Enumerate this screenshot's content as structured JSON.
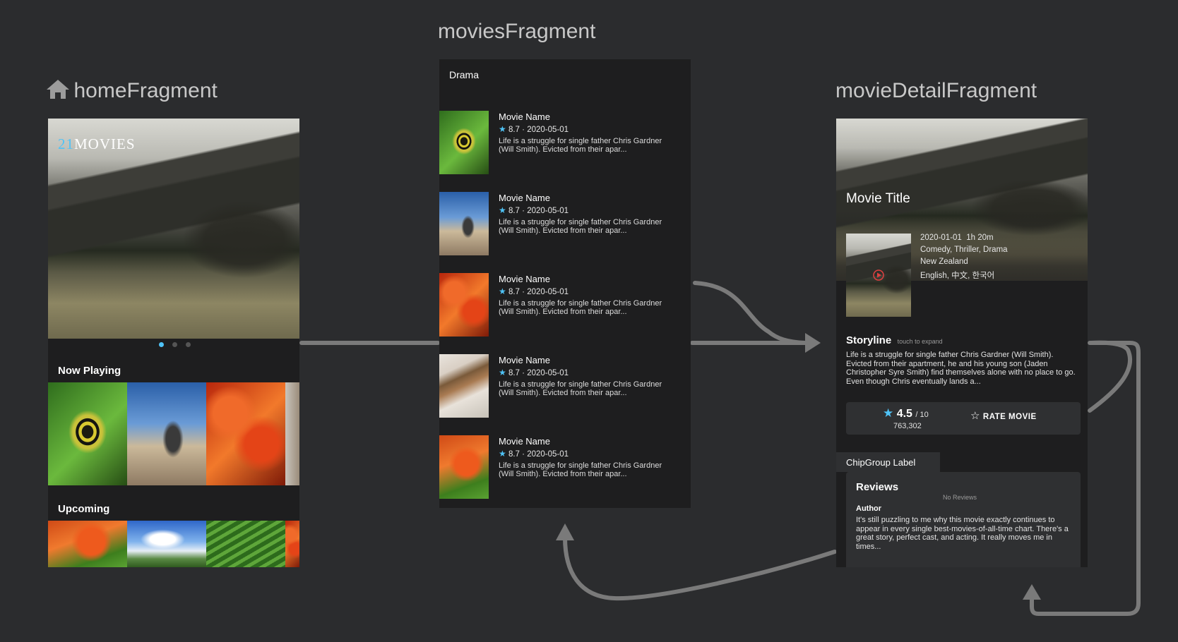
{
  "home": {
    "title": "homeFragment",
    "logo_part1": "21",
    "logo_part2": "MOVIES",
    "now_playing": "Now Playing",
    "upcoming": "Upcoming"
  },
  "movies": {
    "title": "moviesFragment",
    "genre": "Drama",
    "items": [
      {
        "name": "Movie Name",
        "rating": "8.7",
        "date": "2020-05-01",
        "desc": "Life is a struggle for single father Chris Gardner (Will Smith). Evicted from their apar..."
      },
      {
        "name": "Movie Name",
        "rating": "8.7",
        "date": "2020-05-01",
        "desc": "Life is a struggle for single father Chris Gardner (Will Smith). Evicted from their apar..."
      },
      {
        "name": "Movie Name",
        "rating": "8.7",
        "date": "2020-05-01",
        "desc": "Life is a struggle for single father Chris Gardner (Will Smith). Evicted from their apar..."
      },
      {
        "name": "Movie Name",
        "rating": "8.7",
        "date": "2020-05-01",
        "desc": "Life is a struggle for single father Chris Gardner (Will Smith). Evicted from their apar..."
      },
      {
        "name": "Movie Name",
        "rating": "8.7",
        "date": "2020-05-01",
        "desc": "Life is a struggle for single father Chris Gardner (Will Smith). Evicted from their apar..."
      }
    ]
  },
  "detail": {
    "title": "movieDetailFragment",
    "movie_title": "Movie Title",
    "date": "2020-01-01",
    "runtime": "1h 20m",
    "genres": "Comedy, Thriller, Drama",
    "country": "New Zealand",
    "languages": "English, 中文, 한국어",
    "storyline": "Storyline",
    "touch_hint": "touch to expand",
    "storyline_text": "Life is a struggle for single father Chris Gardner (Will Smith). Evicted from their apartment, he and his young son (Jaden Christopher Syre Smith) find themselves alone with no place to go. Even though Chris eventually lands a...",
    "rating": "4.5",
    "rating_max": "/ 10",
    "vote_count": "763,302",
    "rate_button": "RATE MOVIE",
    "chip_label": "ChipGroup Label",
    "reviews": "Reviews",
    "no_reviews": "No Reviews",
    "author": "Author",
    "review_text": "It's still puzzling to me why this movie exactly continues to appear in every single best-movies-of-all-time chart. There's a great story, perfect cast, and acting. It really moves me in times..."
  },
  "colors": {
    "background": "#2b2c2e",
    "accent": "#4fc3f7",
    "arrow": "#7a7a7a"
  }
}
